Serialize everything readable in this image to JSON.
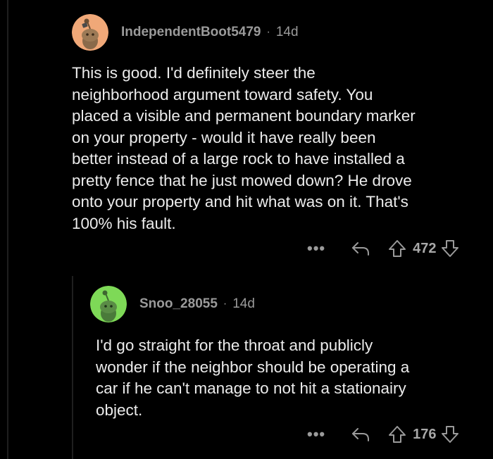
{
  "comments": [
    {
      "author": "IndependentBoot5479",
      "separator": "·",
      "age": "14d",
      "avatar_color": "#f0a878",
      "lines": [
        "This is good. I'd definitely steer the",
        "neighborhood argument toward safety. You",
        "placed a visible and permanent boundary marker",
        "on your property - would it have really been",
        "better instead of a large rock to have installed a",
        "pretty fence that he just mowed down? He drove",
        "onto your property and hit what was on it. That's",
        "100% his fault."
      ],
      "more": "•••",
      "score": "472"
    },
    {
      "author": "Snoo_28055",
      "separator": "·",
      "age": "14d",
      "avatar_color": "#7ed957",
      "lines": [
        "I'd go straight for the throat and publicly",
        "wonder if the neighbor should be operating a",
        "car if he can't manage to not hit a stationairy",
        "object."
      ],
      "more": "•••",
      "score": "176"
    }
  ],
  "colors": {
    "background": "#000000",
    "text": "#ececec",
    "meta": "#9a9a9a",
    "thread_line": "#1f1f1f"
  },
  "icons": [
    "snoo-avatar-icon",
    "reply-icon",
    "upvote-icon",
    "downvote-icon",
    "more-icon"
  ]
}
